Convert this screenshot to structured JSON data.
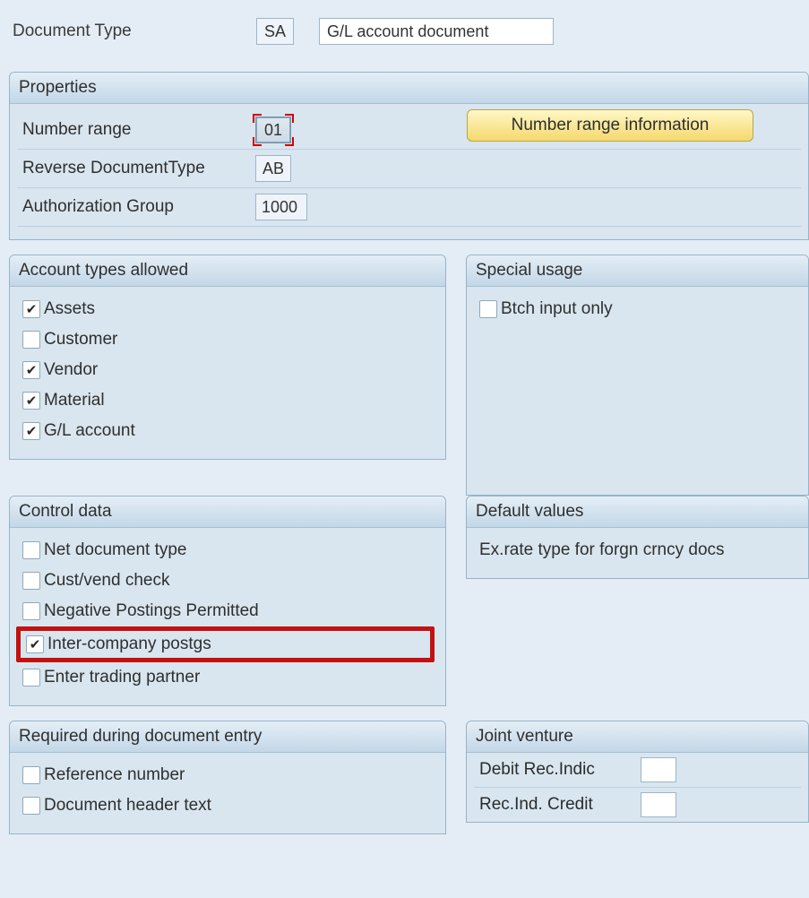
{
  "header": {
    "doc_type_label": "Document Type",
    "doc_type_code": "SA",
    "doc_type_desc": "G/L account document"
  },
  "properties": {
    "title": "Properties",
    "number_range_label": "Number range",
    "number_range_value": "01",
    "reverse_doc_type_label": "Reverse DocumentType",
    "reverse_doc_type_value": "AB",
    "auth_group_label": "Authorization Group",
    "auth_group_value": "1000",
    "info_button": "Number range information"
  },
  "account_types": {
    "title": "Account types allowed",
    "items": [
      {
        "label": "Assets",
        "checked": true
      },
      {
        "label": "Customer",
        "checked": false
      },
      {
        "label": "Vendor",
        "checked": true
      },
      {
        "label": "Material",
        "checked": true
      },
      {
        "label": "G/L account",
        "checked": true
      }
    ]
  },
  "special_usage": {
    "title": "Special usage",
    "items": [
      {
        "label": "Btch input only",
        "checked": false
      }
    ]
  },
  "control_data": {
    "title": "Control data",
    "items": [
      {
        "label": "Net document type",
        "checked": false,
        "highlight": false
      },
      {
        "label": "Cust/vend check",
        "checked": false,
        "highlight": false
      },
      {
        "label": "Negative Postings Permitted",
        "checked": false,
        "highlight": false
      },
      {
        "label": "Inter-company postgs",
        "checked": true,
        "highlight": true
      },
      {
        "label": "Enter trading partner",
        "checked": false,
        "highlight": false
      }
    ]
  },
  "default_values": {
    "title": "Default values",
    "ex_rate_label": "Ex.rate type for forgn crncy docs"
  },
  "required_entry": {
    "title": "Required during document entry",
    "items": [
      {
        "label": "Reference number",
        "checked": false
      },
      {
        "label": "Document header text",
        "checked": false
      }
    ]
  },
  "joint_venture": {
    "title": "Joint venture",
    "debit_label": "Debit Rec.Indic",
    "credit_label": "Rec.Ind. Credit",
    "debit_value": "",
    "credit_value": ""
  }
}
